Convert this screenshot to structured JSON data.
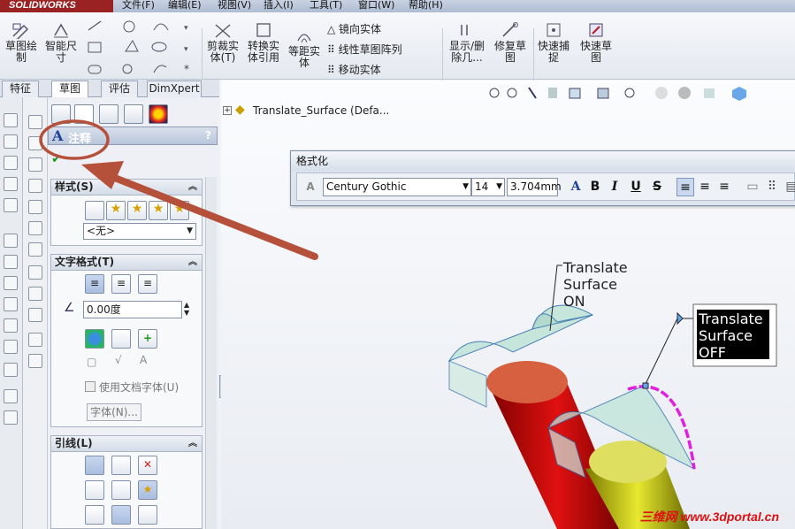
{
  "app": {
    "logo": "SOLIDWORKS"
  },
  "menubar": [
    "文件(F)",
    "编辑(E)",
    "视图(V)",
    "插入(I)",
    "工具(T)",
    "窗口(W)",
    "帮助(H)"
  ],
  "ribbon": {
    "sketch": "草图绘\n制",
    "smart_dim": "智能尺\n寸",
    "trim": "剪裁实\n体(T)",
    "convert": "转换实\n体引用",
    "offset": "等距实\n体",
    "mirror": "镜向实体",
    "linear_pattern": "线性草图阵列",
    "move": "移动实体",
    "show_delete": "显示/删\n除几...",
    "repair": "修复草\n图",
    "quick_snap": "快速捕\n捉",
    "rapid_sketch": "快速草\n图"
  },
  "tabs": [
    "特征",
    "草图",
    "评估",
    "DimXpert"
  ],
  "active_tab": "草图",
  "feature_tree": {
    "part": "Translate_Surface  (Defa..."
  },
  "pm": {
    "title": "注释",
    "help": "?",
    "style_section": "样式(S)",
    "style_select": "<无>",
    "text_format_section": "文字格式(T)",
    "angle_value": "0.00度",
    "use_doc_font": "使用文档字体(U)",
    "font_button": "字体(N)...",
    "leader_section": "引线(L)"
  },
  "format_dialog": {
    "title": "格式化",
    "font": "Century Gothic",
    "size": "14",
    "height": "3.704mm",
    "bold": "B",
    "italic": "I",
    "underline": "U",
    "strike": "S"
  },
  "notes": {
    "on": [
      "Translate",
      "Surface",
      "ON"
    ],
    "off": [
      "Translate",
      "Surface",
      "OFF"
    ]
  },
  "watermark": "三维网 www.3dportal.cn",
  "colors": {
    "accent_red": "#b5503a",
    "magenta": "#e020e0",
    "note_bg": "#000000"
  }
}
